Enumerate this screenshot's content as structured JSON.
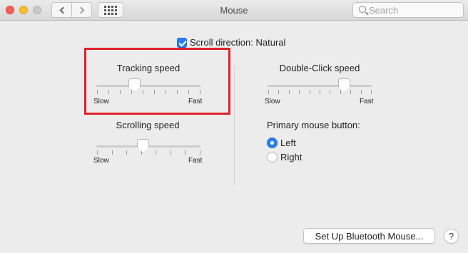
{
  "window": {
    "title": "Mouse"
  },
  "toolbar": {
    "search_placeholder": "Search"
  },
  "scroll_direction": {
    "label": "Scroll direction: Natural",
    "checked": true
  },
  "tracking_speed": {
    "label": "Tracking speed",
    "min_label": "Slow",
    "max_label": "Fast",
    "value": 0.35,
    "ticks": 10
  },
  "scrolling_speed": {
    "label": "Scrolling speed",
    "min_label": "Slow",
    "max_label": "Fast",
    "value": 0.44,
    "ticks": 8
  },
  "double_click_speed": {
    "label": "Double-Click speed",
    "min_label": "Slow",
    "max_label": "Fast",
    "value": 0.77,
    "ticks": 11
  },
  "primary_button": {
    "label": "Primary mouse button:",
    "options": [
      {
        "label": "Left",
        "selected": true
      },
      {
        "label": "Right",
        "selected": false
      }
    ]
  },
  "buttons": {
    "bluetooth": "Set Up Bluetooth Mouse...",
    "help": "?"
  },
  "colors": {
    "accent": "#2a7ff6",
    "highlight": "#e0222a"
  }
}
